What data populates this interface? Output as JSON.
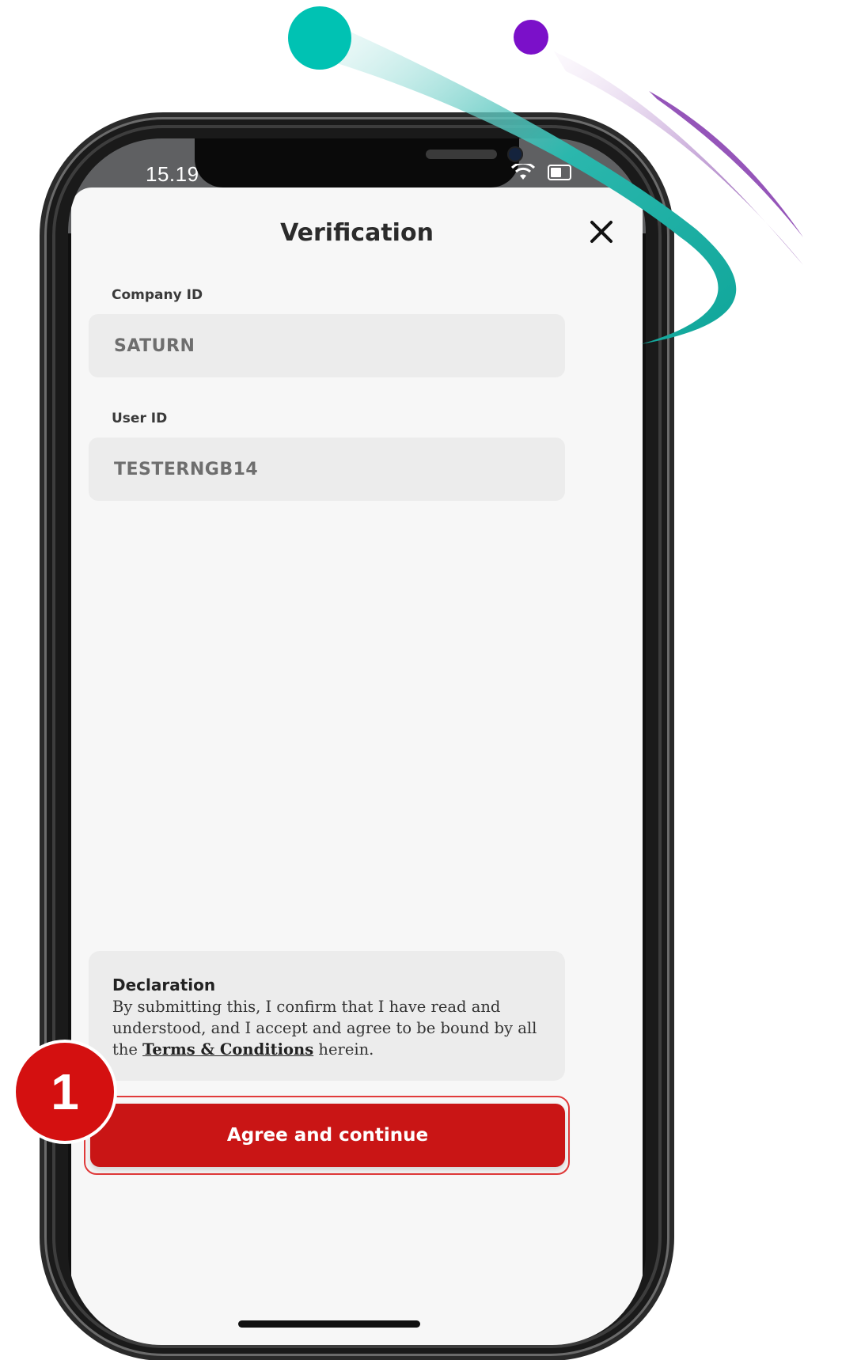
{
  "status_bar": {
    "time": "15.19",
    "wifi_icon": "wifi-icon",
    "battery_icon": "battery-icon"
  },
  "sheet": {
    "title": "Verification",
    "close_icon": "close-icon",
    "company_id": {
      "label": "Company ID",
      "value": "SATURN"
    },
    "user_id": {
      "label": "User ID",
      "value": "TESTERNGB14"
    },
    "declaration": {
      "title": "Declaration",
      "text_before": "By submitting this, I confirm that I have read and understood, and I accept and agree to be bound by all the ",
      "link": "Terms & Conditions",
      "text_after": " herein."
    },
    "cta_label": "Agree and continue"
  },
  "step_badge": "1",
  "colors": {
    "cta": "#c91515",
    "badge": "#d41010",
    "teal_dot": "#00c2b3",
    "purple_dot": "#7b10c9"
  }
}
